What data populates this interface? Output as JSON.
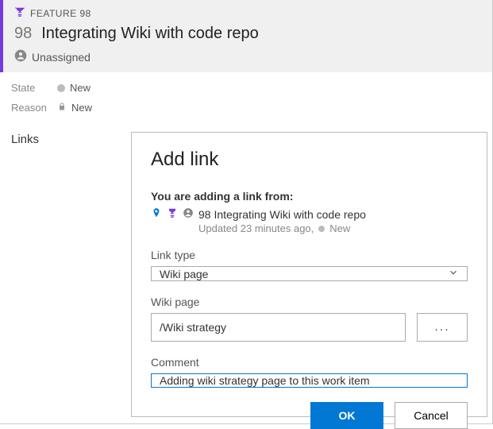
{
  "header": {
    "type_label": "FEATURE 98",
    "id": "98",
    "title": "Integrating Wiki with code repo",
    "assigned": "Unassigned"
  },
  "meta": {
    "state_label": "State",
    "state_value": "New",
    "reason_label": "Reason",
    "reason_value": "New"
  },
  "links_heading": "Links",
  "dialog": {
    "title": "Add link",
    "adding_from_label": "You are adding a link from:",
    "from_item": "98 Integrating Wiki with code repo",
    "from_sub": "Updated 23 minutes ago,",
    "from_state": "New",
    "link_type_label": "Link type",
    "link_type_value": "Wiki page",
    "wiki_page_label": "Wiki page",
    "wiki_page_value": "/Wiki strategy",
    "browse_label": "...",
    "comment_label": "Comment",
    "comment_value": "Adding wiki strategy page to this work item",
    "ok_label": "OK",
    "cancel_label": "Cancel"
  }
}
